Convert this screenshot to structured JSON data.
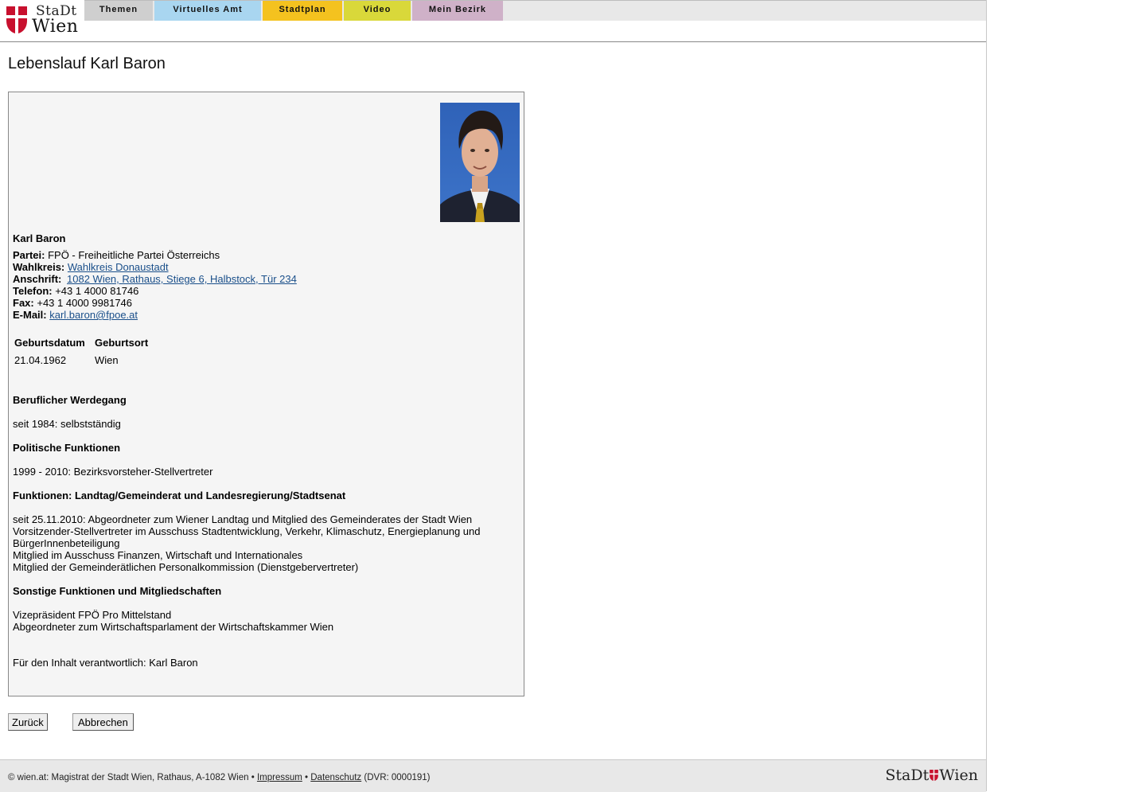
{
  "header": {
    "logo_top": "StaDt",
    "logo_bottom": "Wien",
    "nav": [
      {
        "label": "Themen",
        "color": "#cfcfcf"
      },
      {
        "label": "Virtuelles Amt",
        "color": "#a9d6f0"
      },
      {
        "label": "Stadtplan",
        "color": "#f4c21f"
      },
      {
        "label": "Video",
        "color": "#d9d83a"
      },
      {
        "label": "Mein Bezirk",
        "color": "#cfb1c8"
      }
    ]
  },
  "page_title": "Lebenslauf Karl Baron",
  "profile": {
    "name": "Karl Baron",
    "partei_label": "Partei:",
    "partei_value": "FPÖ - Freiheitliche Partei Österreichs",
    "wahlkreis_label": "Wahlkreis:",
    "wahlkreis_value": "Wahlkreis Donaustadt",
    "anschrift_label": "Anschrift:",
    "anschrift_value": "1082 Wien, Rathaus, Stiege 6, Halbstock, Tür 234",
    "telefon_label": "Telefon:",
    "telefon_value": "+43 1 4000 81746",
    "fax_label": "Fax:",
    "fax_value": "+43 1 4000 9981746",
    "email_label": "E-Mail:",
    "email_value": "karl.baron@fpoe.at"
  },
  "birth_table": {
    "headers": [
      "Geburtsdatum",
      "Geburtsort"
    ],
    "row": [
      "21.04.1962",
      "Wien"
    ]
  },
  "sections": {
    "beruf_heading": "Beruflicher Werdegang",
    "beruf_lines": [
      "seit 1984: selbstständig"
    ],
    "politik_heading": "Politische Funktionen",
    "politik_lines": [
      "1999 - 2010: Bezirksvorsteher-Stellvertreter"
    ],
    "landtag_heading": "Funktionen: Landtag/Gemeinderat und Landesregierung/Stadtsenat",
    "landtag_lines": [
      "seit 25.11.2010: Abgeordneter zum Wiener Landtag und Mitglied des Gemeinderates der Stadt Wien",
      "Vorsitzender-Stellvertreter im Ausschuss Stadtentwicklung, Verkehr, Klimaschutz, Energieplanung und",
      "BürgerInnenbeteiligung",
      "Mitglied im Ausschuss Finanzen, Wirtschaft und Internationales",
      "Mitglied der Gemeinderätlichen Personalkommission (Dienstgebervertreter)"
    ],
    "sonstige_heading": "Sonstige Funktionen und Mitgliedschaften",
    "sonstige_lines": [
      "Vizepräsident FPÖ Pro Mittelstand",
      "Abgeordneter zum Wirtschaftsparlament der Wirtschaftskammer Wien"
    ],
    "verantwortlich": "Für den Inhalt verantwortlich: Karl Baron"
  },
  "buttons": {
    "back": "Zurück",
    "cancel": "Abbrechen"
  },
  "footer": {
    "copyright": "© wien.at: Magistrat der Stadt Wien, Rathaus, A-1082 Wien •",
    "impressum": "Impressum",
    "sep": "•",
    "datenschutz": "Datenschutz",
    "dvr": "(DVR: 0000191)",
    "logo_left": "StaDt",
    "logo_right": "Wien"
  },
  "colors": {
    "wien_red": "#c8102e",
    "link": "#1a4f8a"
  }
}
